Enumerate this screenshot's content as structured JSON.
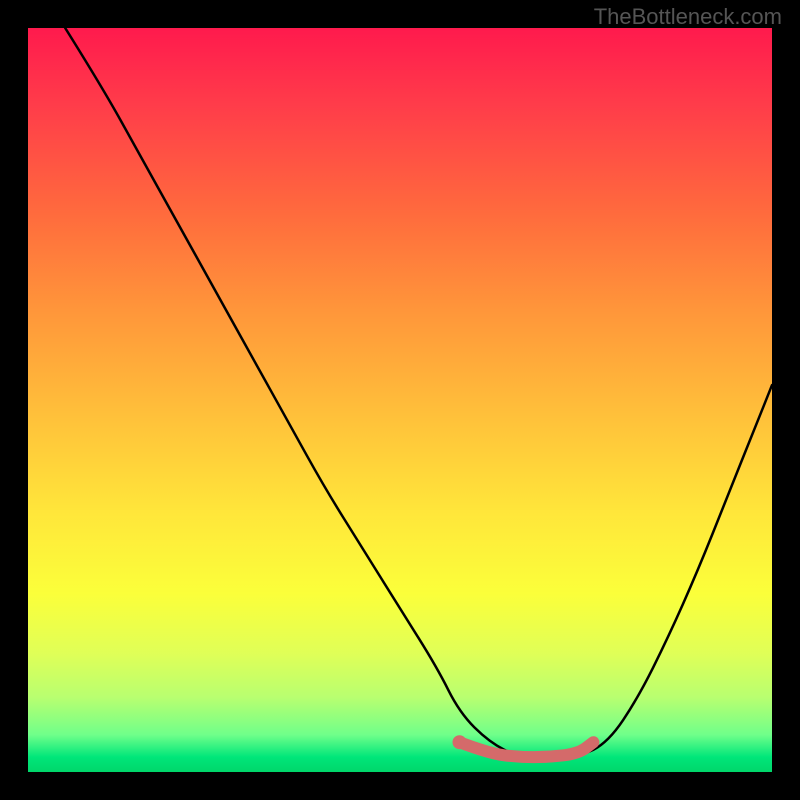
{
  "watermark": "TheBottleneck.com",
  "chart_data": {
    "type": "line",
    "title": "",
    "xlabel": "",
    "ylabel": "",
    "xlim": [
      0,
      100
    ],
    "ylim": [
      0,
      100
    ],
    "series": [
      {
        "name": "bottleneck-curve",
        "x": [
          5,
          10,
          15,
          20,
          25,
          30,
          35,
          40,
          45,
          50,
          55,
          58,
          62,
          66,
          70,
          74,
          78,
          82,
          86,
          90,
          94,
          98,
          100
        ],
        "y": [
          100,
          92,
          83,
          74,
          65,
          56,
          47,
          38,
          30,
          22,
          14,
          8,
          4,
          2,
          2,
          2,
          4,
          10,
          18,
          27,
          37,
          47,
          52
        ]
      },
      {
        "name": "optimal-range-marker",
        "x": [
          58,
          62,
          66,
          70,
          74,
          76
        ],
        "y": [
          4,
          2.5,
          2,
          2,
          2.5,
          4
        ]
      }
    ],
    "gradient_stops": [
      {
        "pos": 0,
        "color": "#ff1a4d"
      },
      {
        "pos": 25,
        "color": "#ff6b3d"
      },
      {
        "pos": 52,
        "color": "#ffc03a"
      },
      {
        "pos": 76,
        "color": "#fbff3a"
      },
      {
        "pos": 95,
        "color": "#70ff8a"
      },
      {
        "pos": 100,
        "color": "#00d66a"
      }
    ]
  }
}
